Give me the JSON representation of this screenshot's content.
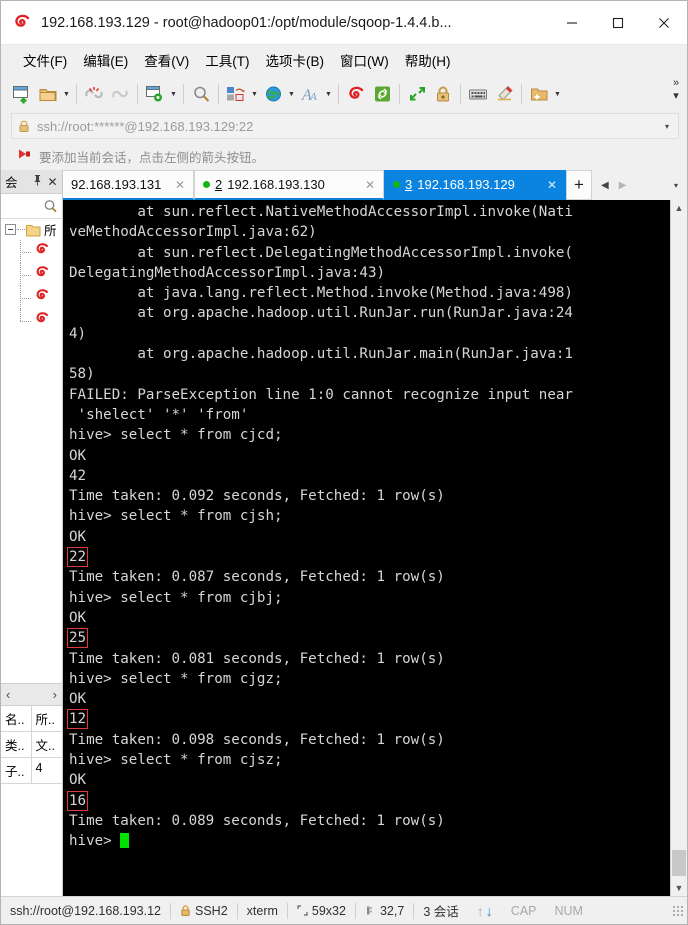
{
  "window": {
    "title": "192.168.193.129 - root@hadoop01:/opt/module/sqoop-1.4.4.b...",
    "minimize": "—",
    "maximize": "▢",
    "close": "✕"
  },
  "menu": {
    "items": [
      {
        "label": "文件(F)",
        "name": "menu-file"
      },
      {
        "label": "编辑(E)",
        "name": "menu-edit"
      },
      {
        "label": "查看(V)",
        "name": "menu-view"
      },
      {
        "label": "工具(T)",
        "name": "menu-tools"
      },
      {
        "label": "选项卡(B)",
        "name": "menu-tabs"
      },
      {
        "label": "窗口(W)",
        "name": "menu-window"
      },
      {
        "label": "帮助(H)",
        "name": "menu-help"
      }
    ]
  },
  "toolbar": {
    "overflow": "»",
    "overflow_caret": "▾",
    "items": [
      {
        "icon": "new-session-icon",
        "caret": false
      },
      {
        "icon": "open-folder-icon",
        "caret": true
      },
      {
        "icon": "disconnect-icon",
        "caret": false
      },
      {
        "icon": "connect-chain-icon",
        "caret": false
      },
      {
        "icon": "session-properties-icon",
        "caret": true
      },
      {
        "icon": "search-icon",
        "caret": false
      },
      {
        "icon": "layout-arrange-icon",
        "caret": true
      },
      {
        "icon": "globe-icon",
        "caret": true
      },
      {
        "icon": "font-icon",
        "caret": true
      },
      {
        "icon": "xshell-logo-icon",
        "caret": false
      },
      {
        "icon": "xftp-icon",
        "caret": false
      },
      {
        "icon": "fullscreen-icon",
        "caret": false
      },
      {
        "icon": "lock-icon",
        "caret": false
      },
      {
        "icon": "keyboard-icon",
        "caret": false
      },
      {
        "icon": "highlight-pen-icon",
        "caret": false
      },
      {
        "icon": "add-folder-icon",
        "caret": true
      }
    ]
  },
  "address": {
    "value": "ssh://root:******@192.168.193.129:22",
    "caret": "▾",
    "lock_icon": "lock-icon"
  },
  "notice": {
    "text": "要添加当前会话，点击左侧的箭头按钮。",
    "icon": "red-arrow-icon"
  },
  "sidebar": {
    "title": "会",
    "pin": "⊥",
    "close": "✕",
    "search_icon": "search-icon",
    "tree": {
      "root_label": "所",
      "children": [
        {
          "label": "",
          "icon": "session-icon"
        },
        {
          "label": "",
          "icon": "session-icon"
        },
        {
          "label": "",
          "icon": "session-icon"
        },
        {
          "label": "",
          "icon": "session-icon"
        }
      ]
    },
    "nav": {
      "prev": "‹",
      "next": "›"
    },
    "properties": [
      {
        "key": "名..",
        "value": "所.."
      },
      {
        "key": "类..",
        "value": "文.."
      },
      {
        "key": "子..",
        "value": "4"
      }
    ]
  },
  "tabs": {
    "items": [
      {
        "num": "",
        "label": "92.168.193.131",
        "active": false,
        "dot": false
      },
      {
        "num": "2",
        "label": "192.168.193.130",
        "active": false,
        "dot": true
      },
      {
        "num": "3",
        "label": "192.168.193.129",
        "active": true,
        "dot": true
      }
    ],
    "new_tab": "+",
    "scroll_left": "◀",
    "scroll_right": "▶",
    "tab_menu": "▾",
    "close_glyph": "✕"
  },
  "terminal": {
    "lines": [
      "        at sun.reflect.NativeMethodAccessorImpl.invoke(Nati",
      "veMethodAccessorImpl.java:62)",
      "        at sun.reflect.DelegatingMethodAccessorImpl.invoke(",
      "DelegatingMethodAccessorImpl.java:43)",
      "        at java.lang.reflect.Method.invoke(Method.java:498)",
      "        at org.apache.hadoop.util.RunJar.run(RunJar.java:24",
      "4)",
      "        at org.apache.hadoop.util.RunJar.main(RunJar.java:1",
      "58)",
      "FAILED: ParseException line 1:0 cannot recognize input near",
      " 'shelect' '*' 'from'",
      "hive> select * from cjcd;",
      "OK",
      "42",
      "Time taken: 0.092 seconds, Fetched: 1 row(s)",
      "hive> select * from cjsh;",
      "OK",
      "22",
      "Time taken: 0.087 seconds, Fetched: 1 row(s)",
      "hive> select * from cjbj;",
      "OK",
      "25",
      "Time taken: 0.081 seconds, Fetched: 1 row(s)",
      "hive> select * from cjgz;",
      "OK",
      "12",
      "Time taken: 0.098 seconds, Fetched: 1 row(s)",
      "hive> select * from cjsz;",
      "OK",
      "16",
      "Time taken: 0.089 seconds, Fetched: 1 row(s)",
      "hive> "
    ],
    "highlighted_line_indexes": [
      17,
      21,
      25,
      29
    ],
    "highlight_color": "#e03a3a",
    "cursor_color": "#00e000",
    "prompt": "hive>"
  },
  "statusbar": {
    "connection": "ssh://root@192.168.193.12",
    "protocol": "SSH2",
    "terminal_type": "xterm",
    "size_icon": "screen-size-icon",
    "size": "59x32",
    "cursor_icon": "cursor-pos-icon",
    "cursor_pos": "32,7",
    "sessions": "3 会话",
    "upload": "↑",
    "download": "↓",
    "caps": "CAP",
    "num": "NUM"
  }
}
